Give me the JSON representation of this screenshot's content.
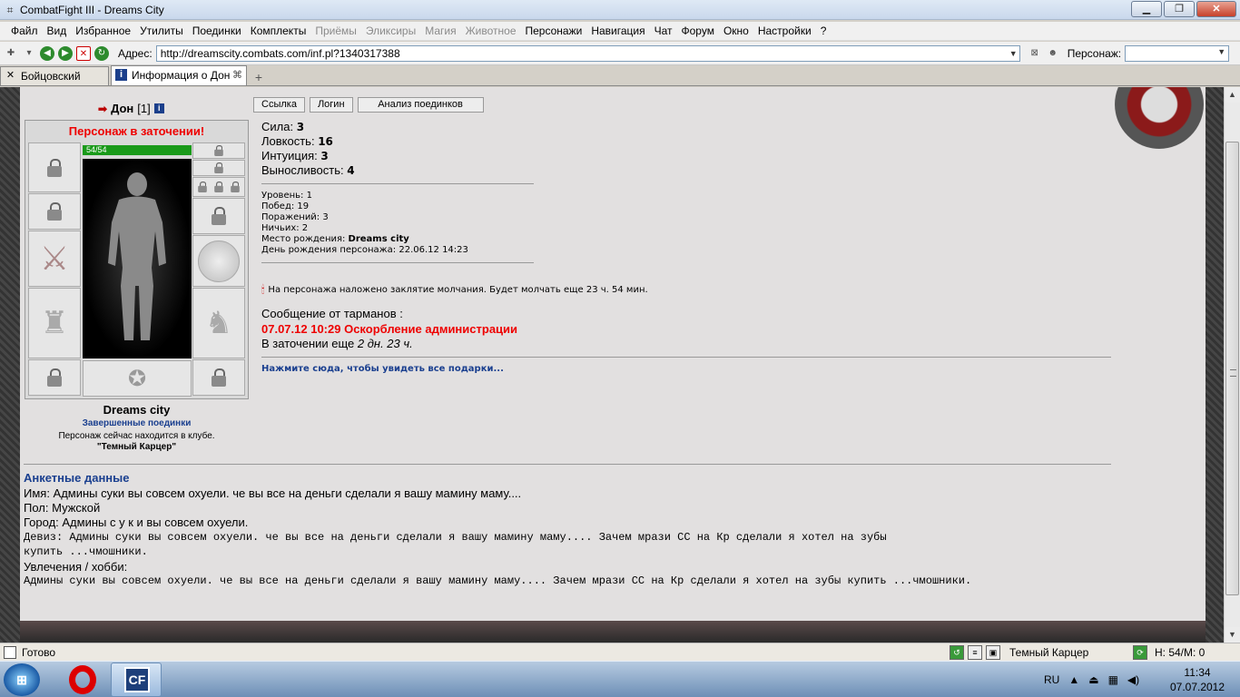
{
  "window": {
    "title": "CombatFight III - Dreams City"
  },
  "menu": [
    "Файл",
    "Вид",
    "Избранное",
    "Утилиты",
    "Поединки",
    "Комплекты",
    "Приёмы",
    "Эликсиры",
    "Магия",
    "Животное",
    "Персонажи",
    "Навигация",
    "Чат",
    "Форум",
    "Окно",
    "Настройки",
    "?"
  ],
  "menu_disabled": [
    "Приёмы",
    "Эликсиры",
    "Магия",
    "Животное"
  ],
  "address": {
    "label": "Адрес:",
    "url": "http://dreamscity.combats.com/inf.pl?1340317388"
  },
  "person": {
    "label": "Персонаж:",
    "value": ""
  },
  "tabs": [
    {
      "label": "Бойцовский клуб",
      "active": false
    },
    {
      "label": "Информация о Дон",
      "active": true
    }
  ],
  "character": {
    "name": "Дон",
    "level": "[1]",
    "prison_text": "Персонаж в заточении!",
    "hp": "54/54",
    "hp_fraction": 1.0,
    "club": "Dreams city",
    "finished_link": "Завершенные поединки",
    "location_note": "Персонаж сейчас находится в клубе.",
    "location_name": "\"Темный Карцер\""
  },
  "buttons": {
    "link": "Ссылка",
    "login": "Логин",
    "analysis": "Анализ поединков"
  },
  "stats": [
    {
      "label": "Сила:",
      "value": "3"
    },
    {
      "label": "Ловкость:",
      "value": "16"
    },
    {
      "label": "Интуиция:",
      "value": "3"
    },
    {
      "label": "Выносливость:",
      "value": "4"
    }
  ],
  "info": {
    "level": "Уровень: 1",
    "wins": "Побед: 19",
    "losses": "Поражений: 3",
    "draws": "Ничьих: 2",
    "birthplace_label": "Место рождения: ",
    "birthplace": "Dreams city",
    "birthday": "День рождения персонажа: 22.06.12 14:23"
  },
  "silence": "На персонажа наложено заклятие молчания. Будет молчать еще 23 ч. 54 мин.",
  "message": {
    "header": "Сообщение от тарманов :",
    "reason": "07.07.12 10:29 Оскорбление администрации",
    "remaining_label": "В заточении еще ",
    "remaining": "2 дн. 23 ч."
  },
  "gifts_link": "Нажмите сюда, чтобы увидеть все подарки...",
  "profile": {
    "title": "Анкетные данные",
    "name": "Имя: Админы суки вы совсем охуели. че вы все на деньги сделали я вашу мамину маму....",
    "gender": "Пол: Мужской",
    "city": "Город: Админы с у к и вы совсем охуели.",
    "motto_1": "Девиз: Админы суки вы совсем охуели. че вы все на деньги сделали я вашу мамину маму.... Зачем мрази СС на Кр сделали я хотел на зубы",
    "motto_2": "купить ...чмошники.",
    "hobby_label": "Увлечения / хобби:",
    "hobby": "Админы суки вы совсем охуели. че вы все на деньги сделали я вашу мамину маму.... Зачем мрази СС на Кр сделали я хотел на зубы купить ...чмошники."
  },
  "status": {
    "ready": "Готово",
    "location": "Темный Карцер",
    "hm": "H: 54/M: 0"
  },
  "taskbar": {
    "cf_label": "CF",
    "lang": "RU",
    "time": "11:34",
    "date": "07.07.2012"
  },
  "colors": {
    "prison_red": "#e00000",
    "link_blue": "#1a3f8f",
    "hp_green": "#1a9a1a"
  }
}
